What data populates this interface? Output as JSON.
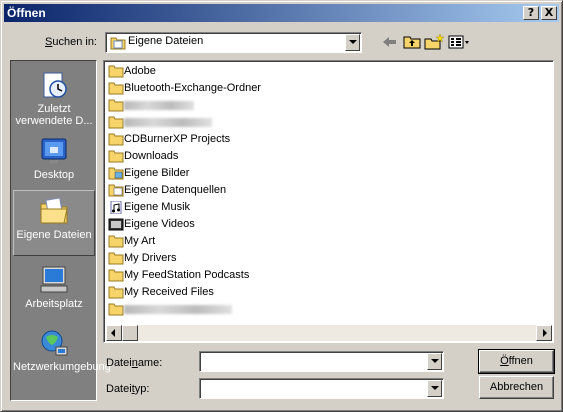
{
  "window": {
    "title": "Öffnen",
    "help_glyph": "?",
    "close_glyph": "X"
  },
  "lookin": {
    "label_pre": "",
    "label_ul": "S",
    "label_post": "uchen in:",
    "value": "Eigene Dateien"
  },
  "toolbar": {
    "back": "back-arrow-icon",
    "up": "folder-up-icon",
    "newfolder": "new-folder-icon",
    "views": "views-menu-icon"
  },
  "places": [
    {
      "label": "Zuletzt verwendete D...",
      "icon": "recent-documents-icon"
    },
    {
      "label": "Desktop",
      "icon": "desktop-icon"
    },
    {
      "label": "Eigene Dateien",
      "icon": "my-documents-icon",
      "selected": true
    },
    {
      "label": "Arbeitsplatz",
      "icon": "my-computer-icon"
    },
    {
      "label": "Netzwerkumgebung",
      "icon": "network-places-icon"
    }
  ],
  "files": [
    {
      "name": "Adobe",
      "icon": "folder"
    },
    {
      "name": "Bluetooth-Exchange-Ordner",
      "icon": "folder"
    },
    {
      "name": "",
      "icon": "folder",
      "redacted": true
    },
    {
      "name": "",
      "icon": "folder",
      "redacted": true
    },
    {
      "name": "CDBurnerXP Projects",
      "icon": "folder"
    },
    {
      "name": "Downloads",
      "icon": "folder"
    },
    {
      "name": "Eigene Bilder",
      "icon": "pictures-folder"
    },
    {
      "name": "Eigene Datenquellen",
      "icon": "datasources-folder"
    },
    {
      "name": "Eigene Musik",
      "icon": "music-folder"
    },
    {
      "name": "Eigene Videos",
      "icon": "videos-folder"
    },
    {
      "name": "My Art",
      "icon": "folder"
    },
    {
      "name": "My Drivers",
      "icon": "folder"
    },
    {
      "name": "My FeedStation Podcasts",
      "icon": "folder"
    },
    {
      "name": "My Received Files",
      "icon": "folder"
    },
    {
      "name": "",
      "icon": "folder",
      "redacted": true
    }
  ],
  "filename": {
    "label_pre": "Datei",
    "label_ul": "n",
    "label_post": "ame:",
    "value": ""
  },
  "filetype": {
    "label_pre": "Datei",
    "label_ul": "t",
    "label_post": "yp:",
    "value": ""
  },
  "buttons": {
    "open_pre": "",
    "open_ul": "Ö",
    "open_post": "ffnen",
    "cancel": "Abbrechen"
  }
}
